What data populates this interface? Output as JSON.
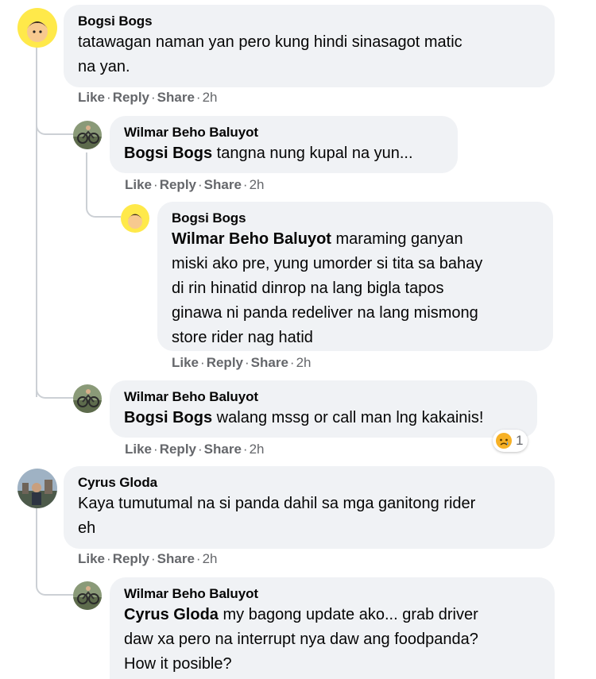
{
  "comments": [
    {
      "author": "Bogsi Bogs",
      "mention": "",
      "text": "tatawagan naman yan pero kung hindi sinasagot matic\nna yan.",
      "actions": {
        "like": "Like",
        "reply": "Reply",
        "share": "Share",
        "time": "2h"
      }
    },
    {
      "author": "Wilmar Beho Baluyot",
      "mention": "Bogsi Bogs",
      "text": " tangna nung kupal na yun...",
      "actions": {
        "like": "Like",
        "reply": "Reply",
        "share": "Share",
        "time": "2h"
      }
    },
    {
      "author": "Bogsi Bogs",
      "mention": "Wilmar Beho Baluyot",
      "text": " maraming ganyan\nmiski ako pre, yung umorder si tita sa bahay\ndi rin hinatid dinrop na lang bigla tapos\nginawa ni panda redeliver na lang mismong\nstore rider nag hatid",
      "actions": {
        "like": "Like",
        "reply": "Reply",
        "share": "Share",
        "time": "2h"
      }
    },
    {
      "author": "Wilmar Beho Baluyot",
      "mention": "Bogsi Bogs",
      "text": " walang mssg or call man lng kakainis!",
      "actions": {
        "like": "Like",
        "reply": "Reply",
        "share": "Share",
        "time": "2h"
      },
      "reaction": {
        "icon": "sad-face-icon",
        "count": "1"
      }
    },
    {
      "author": "Cyrus Gloda",
      "mention": "",
      "text": "Kaya tumutumal na si panda dahil sa mga ganitong rider\neh",
      "actions": {
        "like": "Like",
        "reply": "Reply",
        "share": "Share",
        "time": "2h"
      }
    },
    {
      "author": "Wilmar Beho Baluyot",
      "mention": "Cyrus Gloda",
      "text": " my bagong update ako... grab driver\ndaw xa pero na interrupt nya daw ang foodpanda?\nHow it posible?",
      "actions": {}
    }
  ],
  "separator": "·",
  "colors": {
    "bubble": "#f0f2f5",
    "meta": "#65676b",
    "line": "#ccd0d5"
  }
}
